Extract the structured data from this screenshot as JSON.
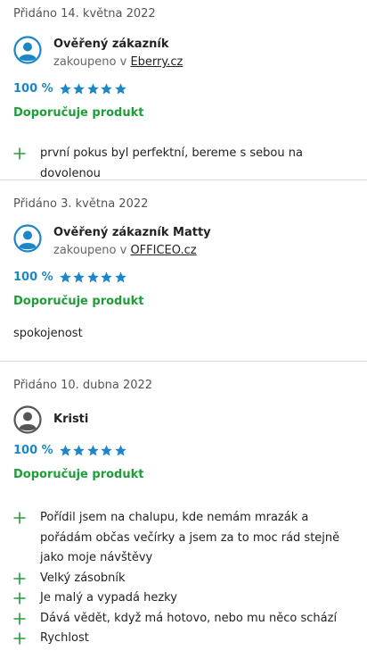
{
  "colors": {
    "accent": "#1d86c6",
    "recommend": "#1f9d39",
    "plus": "#1f9d39",
    "divider": "#d9d9d9"
  },
  "reviews": [
    {
      "date": "Přidáno 14. května 2022",
      "author": "Ověřený zákazník",
      "avatar_icon": "user-avatar-blue-icon",
      "purchased_prefix": "zakoupeno v ",
      "shop": "Eberry.cz",
      "rating_percent": "100 %",
      "stars": 5,
      "recommend": "Doporučuje produkt",
      "pros": [
        "první pokus byl perfektní, bereme s sebou na dovolenou"
      ]
    },
    {
      "date": "Přidáno 3. května 2022",
      "author": "Ověřený zákazník Matty",
      "avatar_icon": "user-avatar-blue-icon",
      "purchased_prefix": "zakoupeno v ",
      "shop": "OFFICEO.cz",
      "rating_percent": "100 %",
      "stars": 5,
      "recommend": "Doporučuje produkt",
      "text": "spokojenost"
    },
    {
      "date": "Přidáno 10. dubna 2022",
      "author": "Kristi",
      "avatar_icon": "user-avatar-gray-icon",
      "rating_percent": "100 %",
      "stars": 5,
      "recommend": "Doporučuje produkt",
      "pros": [
        "Pořídil jsem na chalupu, kde nemám mrazák a pořádám občas večírky a jsem za to moc rád stejně jako moje návštěvy",
        "Velký zásobník",
        "Je malý a vypadá hezky",
        "Dává vědět, když má hotovo, nebo mu něco schází",
        "Rychlost"
      ]
    }
  ]
}
